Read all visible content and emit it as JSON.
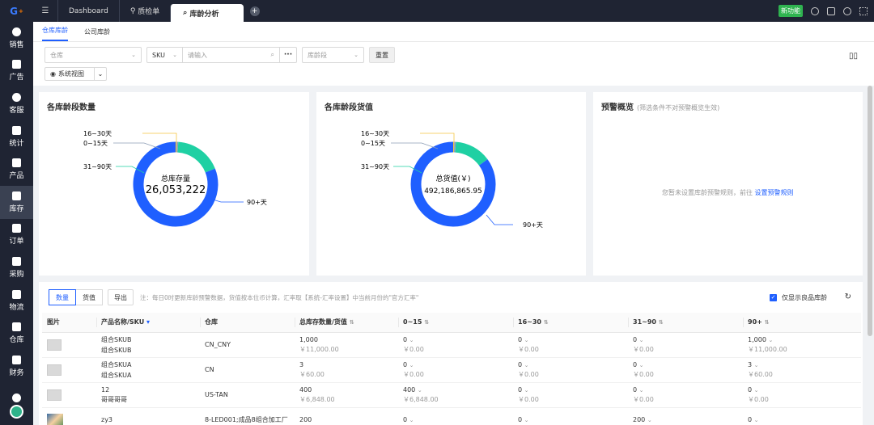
{
  "sidebar": {
    "logo": "G",
    "logo_badge": "+",
    "items": [
      {
        "label": "销售",
        "icon": "chat-icon"
      },
      {
        "label": "广告",
        "icon": "image-icon"
      },
      {
        "label": "客服",
        "icon": "headset-icon"
      },
      {
        "label": "统计",
        "icon": "chart-icon"
      },
      {
        "label": "产品",
        "icon": "cube-icon"
      },
      {
        "label": "库存",
        "icon": "warehouse-icon",
        "active": true
      },
      {
        "label": "订单",
        "icon": "order-icon"
      },
      {
        "label": "采购",
        "icon": "cart-icon"
      },
      {
        "label": "物流",
        "icon": "truck-icon"
      },
      {
        "label": "仓库",
        "icon": "building-icon"
      },
      {
        "label": "财务",
        "icon": "money-icon"
      },
      {
        "label": "",
        "icon": "gear-icon"
      }
    ]
  },
  "topbar": {
    "tabs": [
      "Dashboard",
      "质检单",
      "库龄分析"
    ],
    "new_feature": "新功能"
  },
  "subtabs": [
    "仓库库龄",
    "公司库龄"
  ],
  "filters": {
    "warehouse_placeholder": "仓库",
    "sku_label": "SKU",
    "search_placeholder": "请输入",
    "more": "···",
    "age_placeholder": "库龄段",
    "reset": "重置",
    "view": "系统视图"
  },
  "cards": {
    "qty": {
      "title": "各库龄段数量",
      "center_label": "总库存量",
      "center_value": "26,053,222",
      "labels": [
        "16~30天",
        "0~15天",
        "31~90天",
        "90+天"
      ]
    },
    "value": {
      "title": "各库龄段货值",
      "center_label": "总货值(￥)",
      "center_value": "492,186,865.95",
      "labels": [
        "16~30天",
        "0~15天",
        "31~90天",
        "90+天"
      ]
    },
    "warn": {
      "title": "预警概览",
      "sub": "(筛选条件不对预警概览生效)",
      "text": "您暂未设置库龄预警规则，前往",
      "link": "设置预警规则"
    }
  },
  "colors": {
    "blue": "#1f5fff",
    "teal": "#1fd0a3",
    "yellow": "#f5c542",
    "grey": "#8c9db5"
  },
  "table": {
    "seg": [
      "数量",
      "货值"
    ],
    "export": "导出",
    "note": "注：每日0时更新库龄预警数据，货值按本位币计算，汇率取【系统-汇率设置】中当前月份的\"官方汇率\"",
    "only_good": "仅显示良品库龄",
    "headers": [
      "图片",
      "产品名称/SKU",
      "仓库",
      "总库存数量/货值",
      "0~15",
      "16~30",
      "31~90",
      "90+"
    ],
    "rows": [
      {
        "img": "placeholder",
        "name": "组合SKUB",
        "sku": "组合SKUB",
        "wh": "CN_CNY",
        "total": "1,000",
        "total_v": "￥11,000.00",
        "a": "0",
        "av": "￥0.00",
        "b": "0",
        "bv": "￥0.00",
        "c": "0",
        "cv": "￥0.00",
        "d": "1,000",
        "dv": "￥11,000.00"
      },
      {
        "img": "placeholder",
        "name": "组合SKUA",
        "sku": "组合SKUA",
        "wh": "CN",
        "total": "3",
        "total_v": "￥60.00",
        "a": "0",
        "av": "￥0.00",
        "b": "0",
        "bv": "￥0.00",
        "c": "0",
        "cv": "￥0.00",
        "d": "3",
        "dv": "￥60.00"
      },
      {
        "img": "placeholder",
        "name": "12",
        "sku": "哥哥哥哥",
        "wh": "US-TAN",
        "total": "400",
        "total_v": "￥6,848.00",
        "a": "400",
        "av": "￥6,848.00",
        "b": "0",
        "bv": "￥0.00",
        "c": "0",
        "cv": "￥0.00",
        "d": "0",
        "dv": "￥0.00"
      },
      {
        "img": "photo",
        "name": "zy3",
        "sku": "",
        "wh": "8-LED001;成品8组合加工厂",
        "total": "200",
        "total_v": "",
        "a": "0",
        "av": "",
        "b": "0",
        "bv": "",
        "c": "200",
        "cv": "",
        "d": "0",
        "dv": ""
      }
    ]
  }
}
